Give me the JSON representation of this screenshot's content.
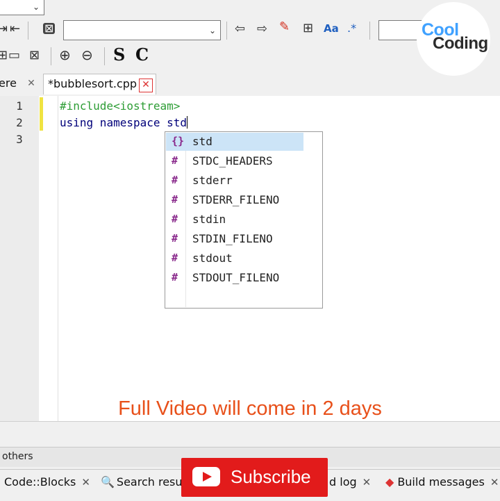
{
  "toolbar": {
    "icons": [
      "jump-icon",
      "stop-icon",
      "prev-icon",
      "next-icon",
      "highlight-icon",
      "bookmark-icon",
      "match-case-icon",
      "regex-icon",
      "zoom-in-icon",
      "zoom-out-icon",
      "s-icon",
      "c-icon"
    ],
    "regex_glyph": ".*",
    "match_case_glyph": "Aa",
    "s_glyph": "S",
    "c_glyph": "C",
    "search_value": "",
    "combo2_value": ""
  },
  "tabs": {
    "prev_label": "ere",
    "active_label": "*bubblesort.cpp",
    "close_glyph": "✕"
  },
  "editor": {
    "line_numbers": [
      "1",
      "2",
      "3"
    ],
    "line1": "#include<iostream>",
    "line2_kw1": "using",
    "line2_rest": " namespace std"
  },
  "autocomplete": {
    "items": [
      {
        "icon": "{}",
        "label": "std"
      },
      {
        "icon": "#",
        "label": "STDC_HEADERS"
      },
      {
        "icon": "#",
        "label": "stderr"
      },
      {
        "icon": "#",
        "label": "STDERR_FILENO"
      },
      {
        "icon": "#",
        "label": "stdin"
      },
      {
        "icon": "#",
        "label": "STDIN_FILENO"
      },
      {
        "icon": "#",
        "label": "stdout"
      },
      {
        "icon": "#",
        "label": "STDOUT_FILENO"
      }
    ],
    "selected_index": 0
  },
  "overlay": {
    "caption": "Full Video will come in 2 days",
    "subscribe_label": "Subscribe"
  },
  "bottom": {
    "others_label": "others",
    "log_tabs": [
      "Code::Blocks",
      "Search result",
      "d log",
      "Build messages"
    ],
    "close_glyph": "✕"
  },
  "logo": {
    "line1": "Cool",
    "line2": "Coding"
  },
  "colors": {
    "accent_red": "#e21b1b",
    "caption_orange": "#e8501a",
    "preprocessor_green": "#2d9d35",
    "keyword_navy": "#00007a",
    "selection_blue": "#cce4f7"
  }
}
